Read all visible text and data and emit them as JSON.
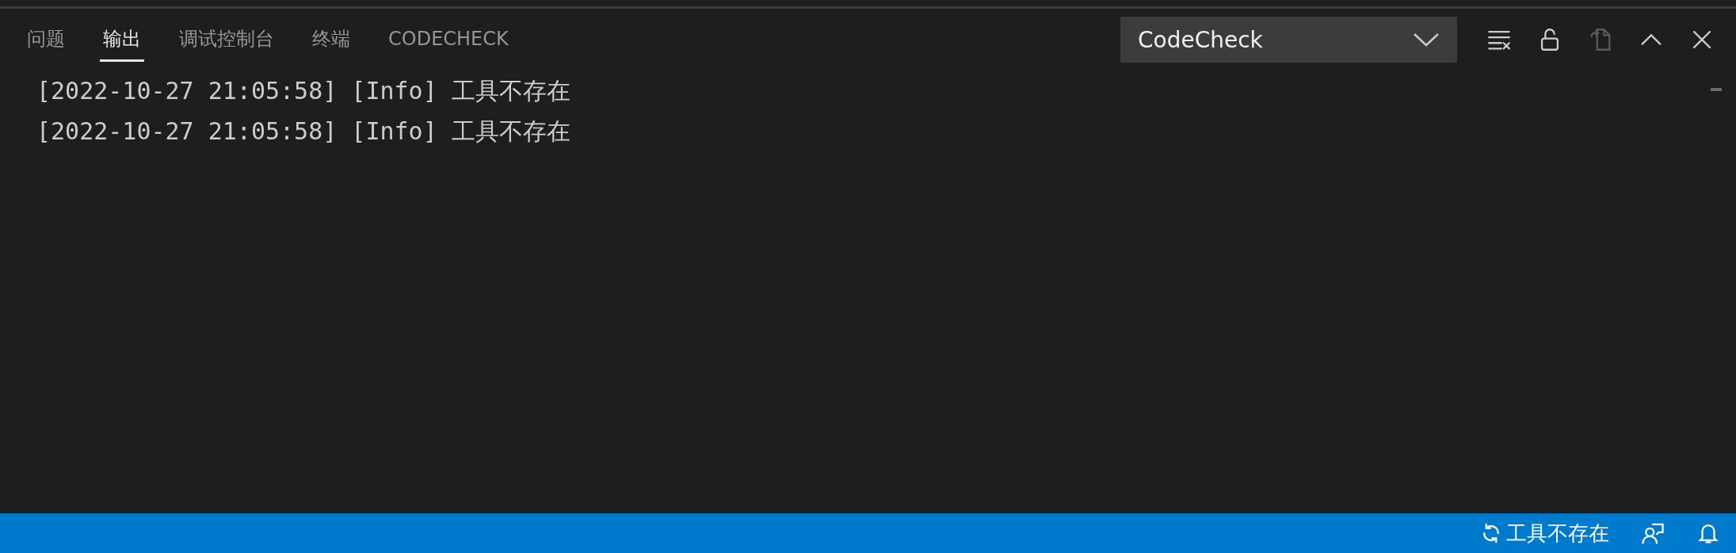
{
  "tabs": [
    {
      "label": "问题",
      "selected": false
    },
    {
      "label": "输出",
      "selected": true
    },
    {
      "label": "调试控制台",
      "selected": false
    },
    {
      "label": "终端",
      "selected": false
    },
    {
      "label": "CODECHECK",
      "selected": false
    }
  ],
  "channel_select": {
    "value": "CodeCheck"
  },
  "actions": [
    {
      "kind": "clear",
      "disabled": false
    },
    {
      "kind": "lock",
      "disabled": false
    },
    {
      "kind": "open",
      "disabled": true
    },
    {
      "kind": "maximize",
      "disabled": false
    },
    {
      "kind": "close",
      "disabled": false
    }
  ],
  "output_lines": [
    "[2022-10-27 21:05:58] [Info] 工具不存在",
    "[2022-10-27 21:05:58] [Info] 工具不存在"
  ],
  "status_bar": {
    "items": [
      {
        "kind": "sync",
        "label": "工具不存在"
      },
      {
        "kind": "feedback"
      },
      {
        "kind": "bell"
      }
    ]
  }
}
